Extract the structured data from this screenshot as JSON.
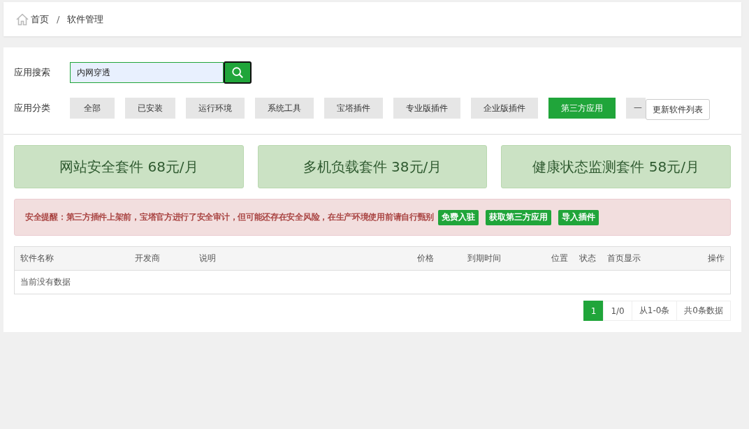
{
  "breadcrumb": [
    {
      "label": "首页",
      "kind": "home"
    },
    {
      "label": "软件管理",
      "kind": "page"
    }
  ],
  "breadcrumb_separator": "/",
  "search": {
    "label": "应用搜索",
    "value": "内网穿透"
  },
  "categories_label": "应用分类",
  "categories": [
    {
      "label": "全部",
      "selected": false
    },
    {
      "label": "已安装",
      "selected": false
    },
    {
      "label": "运行环境",
      "selected": false
    },
    {
      "label": "系统工具",
      "selected": false
    },
    {
      "label": "宝塔插件",
      "selected": false
    },
    {
      "label": "专业版插件",
      "selected": false
    },
    {
      "label": "企业版插件",
      "selected": false
    },
    {
      "label": "第三方应用",
      "selected": true
    },
    {
      "label": "一",
      "selected": false
    }
  ],
  "update_button": "更新软件列表",
  "promos": [
    "网站安全套件 68元/月",
    "多机负载套件 38元/月",
    "健康状态监测套件 58元/月"
  ],
  "alert": {
    "text": "安全提醒：第三方插件上架前，宝塔官方进行了安全审计，但可能还存在安全风险，在生产环境使用前请自行甄别",
    "buttons": [
      "免费入驻",
      "获取第三方应用",
      "导入插件"
    ]
  },
  "table": {
    "columns": [
      "软件名称",
      "开发商",
      "说明",
      "价格",
      "到期时间",
      "位置",
      "状态",
      "首页显示",
      "操作"
    ],
    "empty": "当前没有数据"
  },
  "pagination": [
    {
      "label": "1",
      "selected": true
    },
    {
      "label": "1/0",
      "selected": false
    },
    {
      "label": "从1-0条",
      "selected": false
    },
    {
      "label": "共0条数据",
      "selected": false
    }
  ]
}
